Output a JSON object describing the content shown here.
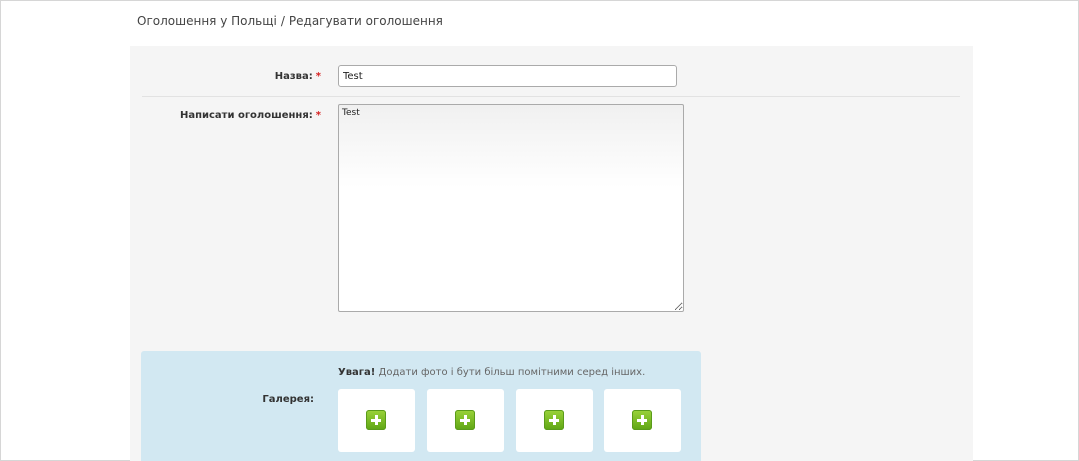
{
  "breadcrumb": {
    "parent": "Оголошення у Польщі",
    "separator": "/",
    "current": "Редагувати оголошення"
  },
  "form": {
    "title_label": "Назва:",
    "title_value": "Test",
    "text_label": "Написати оголошення:",
    "text_value": "Test",
    "required_mark": "*",
    "gallery_label": "Галерея:",
    "gallery_notice_strong": "Увага!",
    "gallery_notice": "Додати фото і бути більш помітними серед інших.",
    "gallery_slots": 4
  },
  "colors": {
    "panel_bg": "#f5f5f5",
    "gallery_bg": "#d2e8f2",
    "required": "#d62020",
    "add_icon": "#7bbd24"
  }
}
